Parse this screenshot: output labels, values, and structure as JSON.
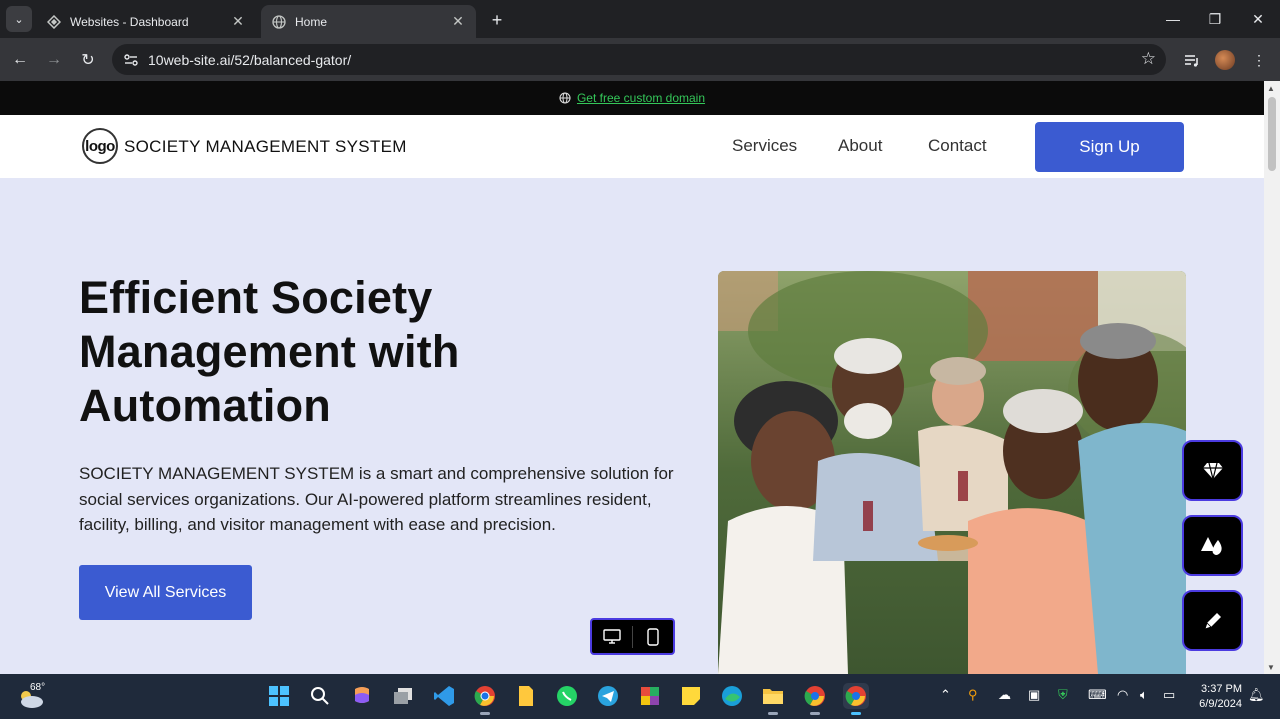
{
  "browser": {
    "tabs": [
      {
        "title": "Websites - Dashboard",
        "active": false
      },
      {
        "title": "Home",
        "active": true
      }
    ],
    "url": "10web-site.ai/52/balanced-gator/"
  },
  "banner": {
    "link_text": "Get free custom domain"
  },
  "header": {
    "logo_text": "logo",
    "site_name": "SOCIETY MANAGEMENT SYSTEM",
    "nav": [
      "Services",
      "About",
      "Contact"
    ],
    "signup_label": "Sign Up"
  },
  "hero": {
    "title": "Efficient Society Management with Automation",
    "description": "SOCIETY MANAGEMENT SYSTEM is a smart and comprehensive solution for social services organizations. Our AI-powered platform streamlines resident, facility, billing, and visitor management with ease and precision.",
    "cta_label": "View All Services"
  },
  "colors": {
    "accent": "#3b5bd1",
    "hero_bg": "#e3e6f7",
    "banner_link": "#34c759",
    "builder_border": "#4b3be0"
  },
  "builder_tools": [
    "diamond-icon",
    "shapes-icon",
    "pencil-icon"
  ],
  "device_toggle": [
    "desktop-icon",
    "mobile-icon"
  ],
  "taskbar": {
    "weather_temp": "68°",
    "apps": [
      "start-icon",
      "search-icon",
      "copilot-icon",
      "task-view-icon",
      "vscode-icon",
      "chrome-icon",
      "files-icon",
      "whatsapp-icon",
      "telegram-icon",
      "app-icon",
      "sticky-notes-icon",
      "edge-icon",
      "file-explorer-icon",
      "chrome-profile-icon",
      "chrome-active-icon"
    ],
    "time": "3:37 PM",
    "date": "6/9/2024"
  }
}
